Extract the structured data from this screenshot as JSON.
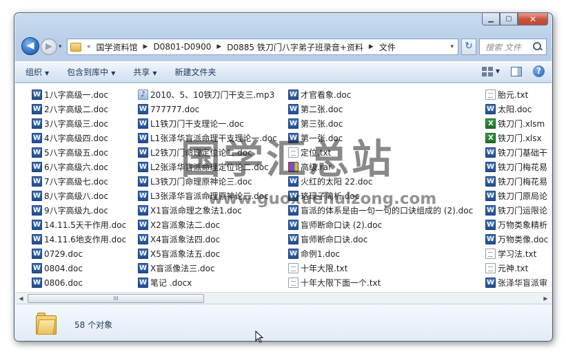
{
  "window": {
    "caption": {
      "minimize": "▁",
      "maximize": "▢",
      "close": "✕"
    }
  },
  "nav": {
    "back": "◀",
    "forward": "▶",
    "dropdown": "▾",
    "lead_sep": "«",
    "breadcrumbs": [
      "国学资料馆",
      "D0801-D0900",
      "D0885 铁刀门八字弟子班录音+资料",
      "文件"
    ],
    "crumb_sep": "▶",
    "refresh": "↻",
    "search_placeholder": "搜索 文件"
  },
  "toolbar": {
    "items": [
      {
        "label": "组织",
        "arrow": "▼"
      },
      {
        "label": "包含到库中",
        "arrow": "▼"
      },
      {
        "label": "共享",
        "arrow": "▼"
      },
      {
        "label": "新建文件夹",
        "arrow": ""
      }
    ],
    "view_dropdown": "▼",
    "help": "?"
  },
  "columns": [
    [
      {
        "name": "1八字高级一.doc",
        "type": "doc"
      },
      {
        "name": "2八字高级二.doc",
        "type": "doc"
      },
      {
        "name": "3八字高级三.doc",
        "type": "doc"
      },
      {
        "name": "4八字高级四.doc",
        "type": "doc"
      },
      {
        "name": "5八字高级五.doc",
        "type": "doc"
      },
      {
        "name": "6八字高级六.doc",
        "type": "doc"
      },
      {
        "name": "7八字高级七.doc",
        "type": "doc"
      },
      {
        "name": "8八字高级八.doc",
        "type": "doc"
      },
      {
        "name": "9八字高级九.doc",
        "type": "doc"
      },
      {
        "name": "14.11.5天干作用.doc",
        "type": "doc"
      },
      {
        "name": "14.11.6地支作用.doc",
        "type": "doc"
      },
      {
        "name": "0729.doc",
        "type": "doc"
      },
      {
        "name": "0804.doc",
        "type": "doc"
      },
      {
        "name": "0806.doc",
        "type": "doc"
      }
    ],
    [
      {
        "name": "2010、5、10铁刀门干支三.mp3",
        "type": "mp3"
      },
      {
        "name": "777777.doc",
        "type": "doc"
      },
      {
        "name": "L1铁刀门干支理论一.doc",
        "type": "doc"
      },
      {
        "name": "L1张泽华盲派命理干支理论一.doc",
        "type": "doc"
      },
      {
        "name": "L2铁刀门命理定位论二.doc",
        "type": "doc"
      },
      {
        "name": "L2张泽华盲派命理定位论二.doc",
        "type": "doc"
      },
      {
        "name": "L3铁刀门命理原神论三.doc",
        "type": "doc"
      },
      {
        "name": "L3张泽华盲派命理原神论三.doc",
        "type": "doc"
      },
      {
        "name": "X1盲派命理之象法1.doc",
        "type": "doc"
      },
      {
        "name": "X2盲派象法二.doc",
        "type": "doc"
      },
      {
        "name": "X4盲派象法四.doc",
        "type": "doc"
      },
      {
        "name": "X5盲派象法五.doc",
        "type": "doc"
      },
      {
        "name": "X盲派像法三.doc",
        "type": "doc"
      },
      {
        "name": "笔记 .docx",
        "type": "doc"
      }
    ],
    [
      {
        "name": "才官看象.doc",
        "type": "doc"
      },
      {
        "name": "第二张.doc",
        "type": "doc"
      },
      {
        "name": "第三张.doc",
        "type": "doc"
      },
      {
        "name": "第一张.doc",
        "type": "doc"
      },
      {
        "name": "定位.txt",
        "type": "txt"
      },
      {
        "name": "高级.rar",
        "type": "rar"
      },
      {
        "name": "火红的太阳 22.doc",
        "type": "doc"
      },
      {
        "name": "珞琭子简析.doc",
        "type": "doc"
      },
      {
        "name": "盲派的体系是由一句一句的口诀组成的 (2).doc",
        "type": "doc"
      },
      {
        "name": "盲师断命口诀 (2).doc",
        "type": "doc"
      },
      {
        "name": "盲师断命口诀.doc",
        "type": "doc"
      },
      {
        "name": "命例1.doc",
        "type": "doc"
      },
      {
        "name": "十年大限.txt",
        "type": "txt"
      },
      {
        "name": "十年大限下面一个.txt",
        "type": "txt"
      }
    ],
    [
      {
        "name": "胎元.txt",
        "type": "txt"
      },
      {
        "name": "太阳.doc",
        "type": "doc"
      },
      {
        "name": "铁刀门.xlsm",
        "type": "xls"
      },
      {
        "name": "铁刀门.xlsx",
        "type": "xls"
      },
      {
        "name": "铁刀门基础干",
        "type": "doc"
      },
      {
        "name": "铁刀门梅花易",
        "type": "doc"
      },
      {
        "name": "铁刀门梅花易",
        "type": "doc"
      },
      {
        "name": "铁刀门原局论",
        "type": "doc"
      },
      {
        "name": "铁刀门运限论",
        "type": "doc"
      },
      {
        "name": "万物类象精析",
        "type": "doc"
      },
      {
        "name": "万物类像.doc",
        "type": "doc"
      },
      {
        "name": "学习法.txt",
        "type": "txt"
      },
      {
        "name": "元神.txt",
        "type": "txt"
      },
      {
        "name": "张泽华盲派审",
        "type": "doc"
      }
    ]
  ],
  "scrollbar": {
    "left_arrow": "◀",
    "right_arrow": "▶",
    "grip": "III"
  },
  "details": {
    "count": "58 个对象"
  },
  "watermark": {
    "text": "国学汇总站",
    "url": "www.guoxuehuizong.com"
  }
}
